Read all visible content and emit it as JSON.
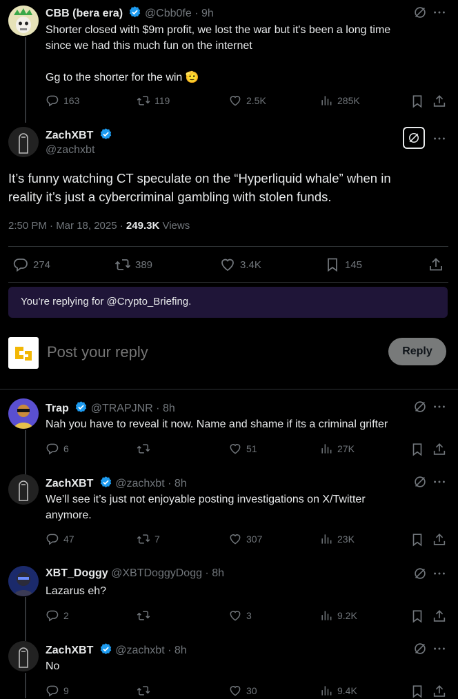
{
  "threads": [
    {
      "name": "CBB (bera era)",
      "handle": "@Cbb0fe",
      "time": "9h",
      "lines": [
        "Shorter closed with $9m profit, we lost the war but it's been a long time",
        "since we had this much fun on the internet",
        "",
        "Gg to the shorter for the win 🫡"
      ],
      "replies": "163",
      "reposts": "119",
      "likes": "2.5K",
      "views": "285K"
    }
  ],
  "main_post": {
    "name": "ZachXBT",
    "handle": "@zachxbt",
    "text_line1": "It’s funny watching CT speculate on the “Hyperliquid whale” when in",
    "text_line2": "reality it’s just a cybercriminal gambling with stolen funds.",
    "timestamp": "2:50 PM · Mar 18, 2025 · ",
    "views_count": "249.3K",
    "views_label": "Views",
    "replies": "274",
    "reposts": "389",
    "likes": "3.4K",
    "bookmarks": "145"
  },
  "reply_notice": "You’re replying for @Crypto_Briefing.",
  "composer": {
    "placeholder": "Post your reply",
    "button": "Reply"
  },
  "replies": [
    {
      "name": "Trap",
      "handle": "@TRAPJNR",
      "time": "8h",
      "lines": [
        "Nah you have to reveal it now. Name and shame if its a criminal grifter"
      ],
      "replies": "6",
      "reposts": "",
      "likes": "51",
      "views": "27K"
    },
    {
      "name": "ZachXBT",
      "handle": "@zachxbt",
      "time": "8h",
      "lines": [
        "We’ll see it’s just not enjoyable posting investigations on X/Twitter",
        "anymore."
      ],
      "replies": "47",
      "reposts": "7",
      "likes": "307",
      "views": "23K"
    },
    {
      "name": "XBT_Doggy",
      "handle": "@XBTDoggyDogg",
      "time": "8h",
      "lines": [
        "Lazarus eh?"
      ],
      "replies": "2",
      "reposts": "",
      "likes": "3",
      "views": "9.2K"
    },
    {
      "name": "ZachXBT",
      "handle": "@zachxbt",
      "time": "8h",
      "lines": [
        "No"
      ],
      "replies": "9",
      "reposts": "",
      "likes": "30",
      "views": "9.4K"
    }
  ],
  "colors": {
    "accent": "#1d9bf0",
    "muted": "#71767b",
    "notice_bg": "#1f1538",
    "reply_btn": "#787a7a"
  }
}
